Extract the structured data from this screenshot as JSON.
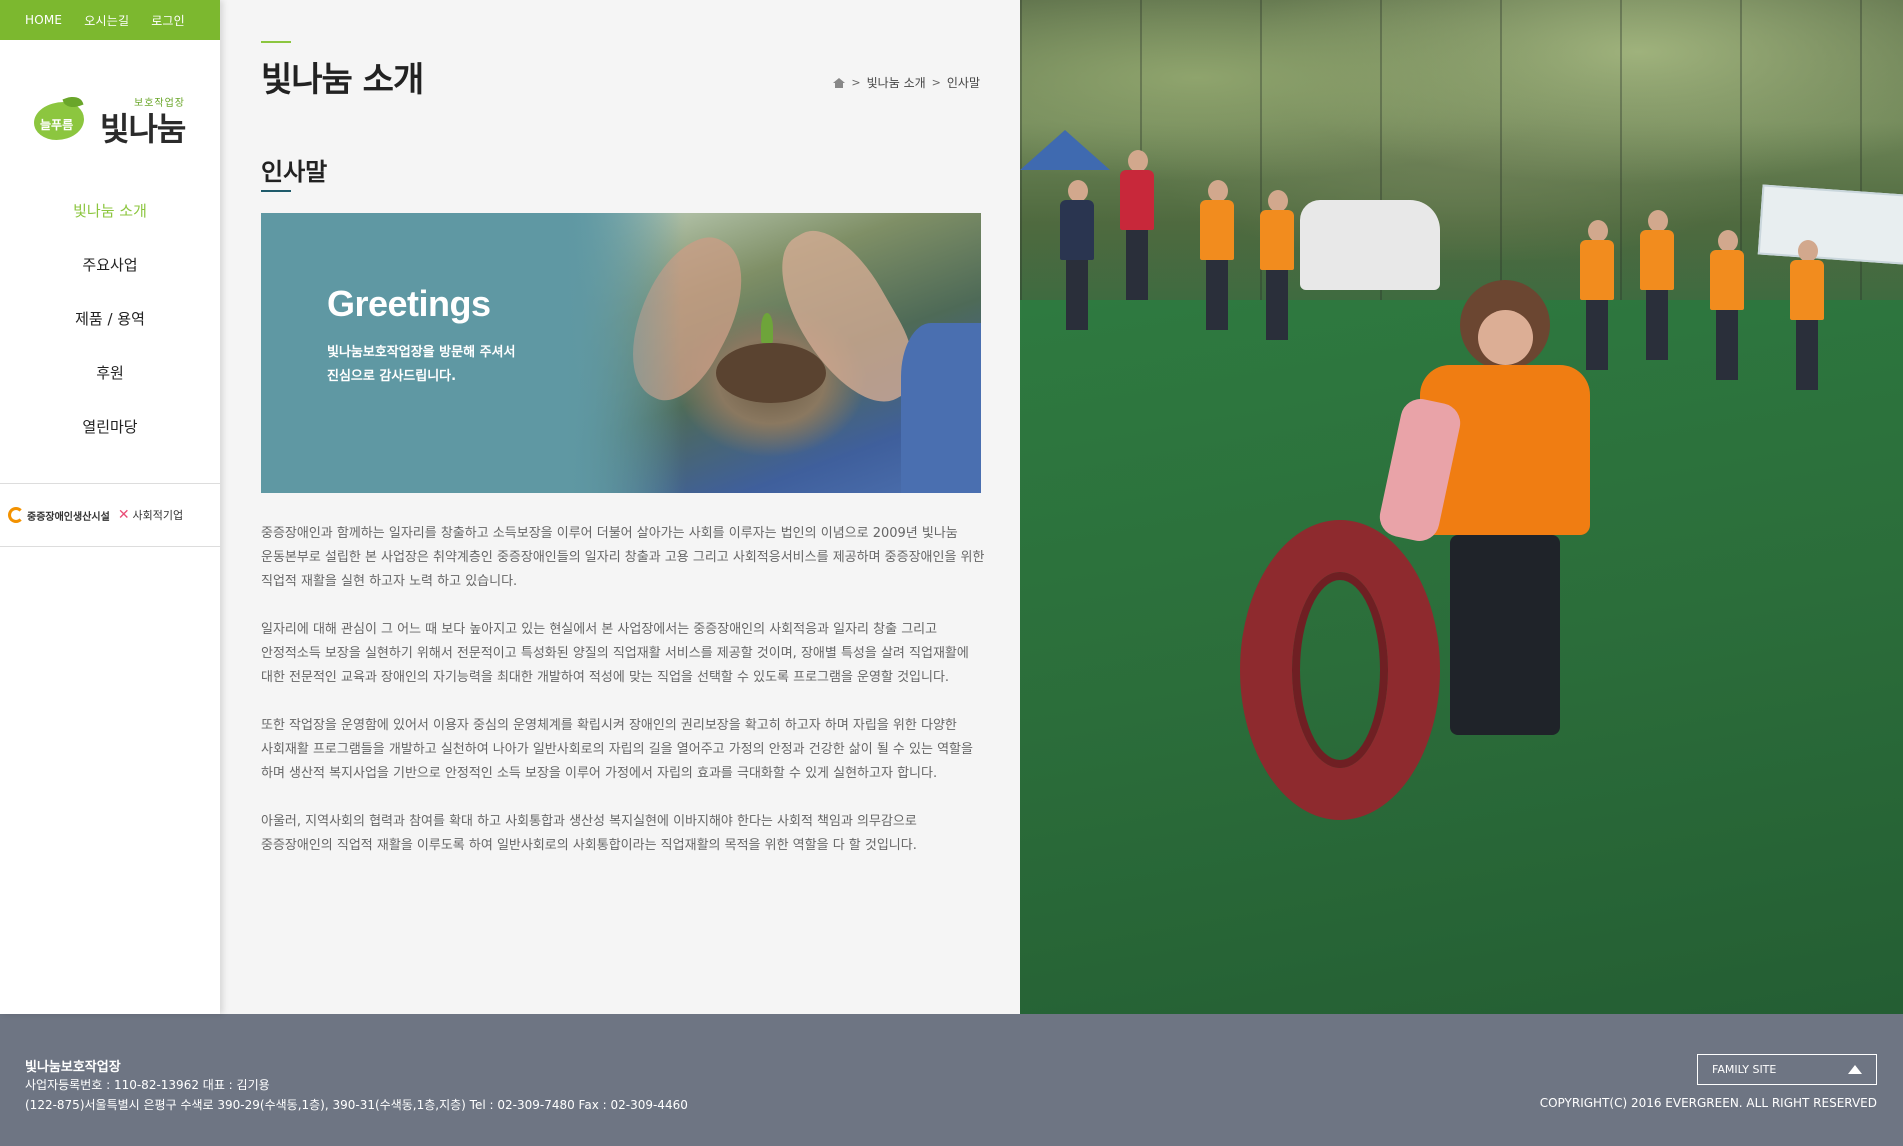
{
  "topbar": {
    "home": "HOME",
    "directions": "오시는길",
    "login": "로그인"
  },
  "logo": {
    "prefix": "보호작업장",
    "small_name": "늘푸름",
    "main_name": "빛나눔"
  },
  "nav": [
    {
      "label": "빛나눔 소개",
      "active": true
    },
    {
      "label": "주요사업",
      "active": false
    },
    {
      "label": "제품 / 용역",
      "active": false
    },
    {
      "label": "후원",
      "active": false
    },
    {
      "label": "열린마당",
      "active": false
    }
  ],
  "partners": {
    "p1": "중증장애인생산시설",
    "p2": "사회적기업"
  },
  "page": {
    "title": "빛나눔 소개",
    "subtitle": "인사말",
    "breadcrumb": [
      "빛나눔 소개",
      "인사말"
    ]
  },
  "banner": {
    "title": "Greetings",
    "line1": "빛나눔보호작업장을 방문해 주셔서",
    "line2": "진심으로 감사드립니다."
  },
  "content": [
    "중증장애인과 함께하는 일자리를 창출하고 소득보장을 이루어 더불어 살아가는 사회를 이루자는 법인의 이념으로 2009년 빛나눔 운동본부로 설립한 본 사업장은 취약계층인 중증장애인들의 일자리 창출과 고용 그리고 사회적응서비스를 제공하며 중증장애인을 위한 직업적 재활을 실현 하고자 노력 하고 있습니다.",
    "일자리에 대해 관심이 그 어느 때 보다 높아지고 있는 현실에서 본 사업장에서는 중증장애인의 사회적응과 일자리 창출 그리고 안정적소득 보장을 실현하기 위해서 전문적이고 특성화된 양질의 직업재활 서비스를 제공할 것이며, 장애별 특성을 살려 직업재활에 대한 전문적인 교육과 장애인의 자기능력을 최대한 개발하여 적성에 맞는 직업을 선택할 수 있도록 프로그램을 운영할 것입니다.",
    "또한 작업장을 운영함에 있어서 이용자 중심의 운영체계를 확립시켜 장애인의 권리보장을 확고히 하고자 하며 자립을 위한 다양한 사회재활 프로그램들을 개발하고 실천하여 나아가 일반사회로의 자립의 길을 열어주고 가정의 안정과 건강한 삶이 될 수 있는 역할을 하며 생산적 복지사업을 기반으로 안정적인 소득 보장을 이루어 가정에서 자립의 효과를 극대화할 수 있게 실현하고자 합니다.",
    "아울러, 지역사회의 협력과 참여를 확대 하고 사회통합과 생산성 복지실현에 이바지해야 한다는 사회적 책임과 의무감으로 중증장애인의 직업적 재활을 이루도록 하여 일반사회로의 사회통합이라는 직업재활의 목적을 위한 역할을 다 할 것입니다."
  ],
  "footer": {
    "name": "빛나눔보호작업장",
    "biz": "사업자등록번호 : 110-82-13962 대표 : 김기용",
    "address": "(122-875)서울특별시 은평구 수색로 390-29(수색동,1층), 390-31(수색동,1층,지층) Tel : 02-309-7480 Fax : 02-309-4460",
    "family_site": "FAMILY SITE",
    "copyright": "COPYRIGHT(C) 2016 EVERGREEN. ALL RIGHT RESERVED"
  },
  "colors": {
    "accent": "#8cc63f",
    "footer": "#6e7583",
    "banner": "#5f98a3"
  }
}
